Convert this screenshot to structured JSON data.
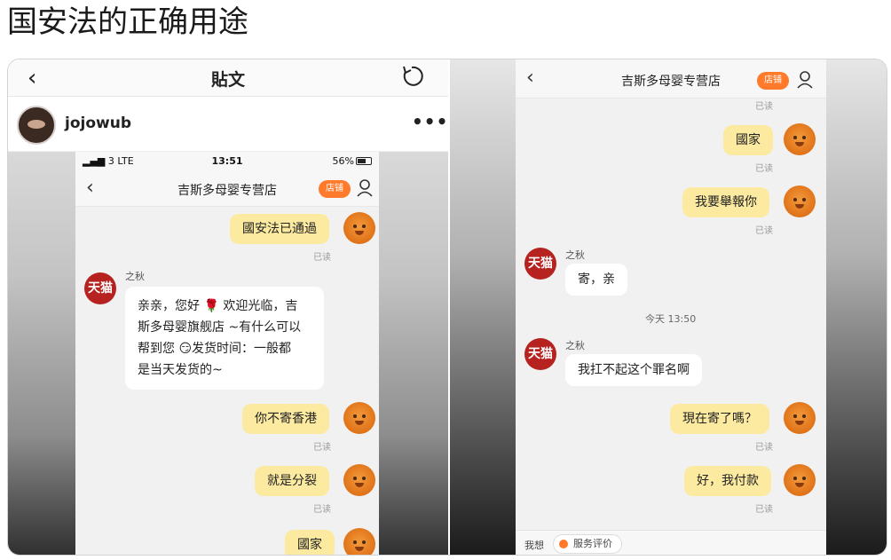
{
  "post": {
    "title": "国安法的正确用途"
  },
  "left_image": {
    "header": {
      "back": "‹",
      "title": "貼文"
    },
    "user": {
      "username": "jojowub",
      "more": "•••"
    },
    "status_bar": {
      "signal": "▂▄▆ 3  LTE",
      "time": "13:51",
      "battery": "56%"
    },
    "chat": {
      "title": "吉斯多母婴专营店",
      "shop_label": "店铺",
      "messages": [
        {
          "text": "國安法已通過",
          "read": "已读"
        },
        {
          "sender": "之秋",
          "avatar": "天猫",
          "lines": [
            "亲亲，您好 🌹 欢迎光临，吉",
            "斯多母婴旗舰店 ~有什么可以",
            "帮到您 😏发货时间：一般都",
            "是当天发货的~"
          ]
        },
        {
          "text": "你不寄香港",
          "read": "已读"
        },
        {
          "text": "就是分裂",
          "read": "已读"
        },
        {
          "text": "國家"
        }
      ]
    }
  },
  "right_image": {
    "chat": {
      "title": "吉斯多母婴专营店",
      "shop_label": "店铺",
      "top_read": "已读",
      "messages": [
        {
          "text": "國家",
          "read": "已读"
        },
        {
          "text": "我要舉報你",
          "read": "已读"
        },
        {
          "sender": "之秋",
          "avatar": "天猫",
          "text": "寄，亲"
        },
        {
          "time": "今天 13:50"
        },
        {
          "sender": "之秋",
          "avatar": "天猫",
          "text": "我扛不起这个罪名啊"
        },
        {
          "text": "現在寄了嗎？",
          "read": "已读"
        },
        {
          "text": "好，我付款",
          "read": "已读"
        }
      ],
      "input_bar": {
        "label": "我想",
        "chip": "服务评价"
      }
    }
  }
}
